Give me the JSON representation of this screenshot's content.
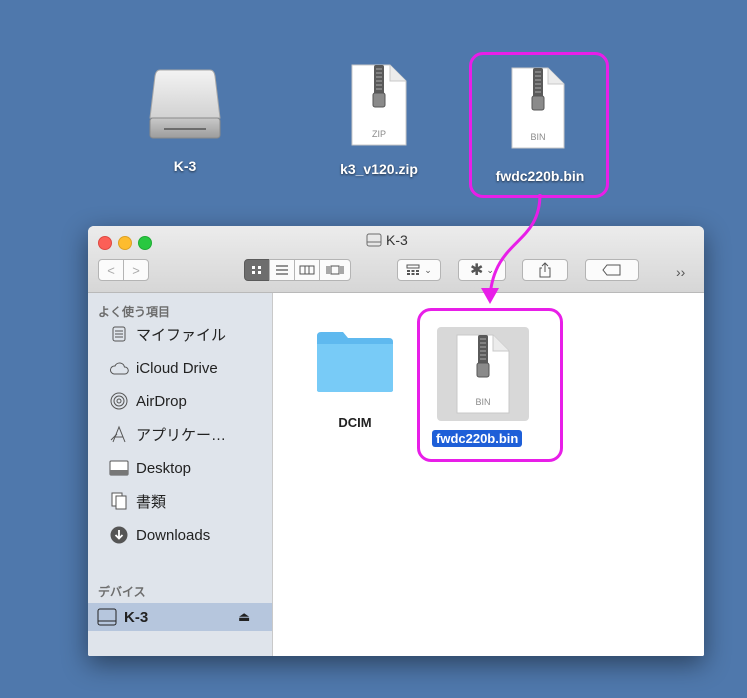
{
  "desktop": {
    "items": [
      {
        "label": "K-3"
      },
      {
        "label": "k3_v120.zip",
        "file_tag": "ZIP"
      },
      {
        "label": "fwdc220b.bin",
        "file_tag": "BIN"
      }
    ]
  },
  "window": {
    "title": "K-3",
    "toolbar": {
      "back": "<",
      "forward": ">",
      "more": "››"
    }
  },
  "sidebar": {
    "favorites_header": "よく使う項目",
    "favorites": [
      {
        "label": "マイファイル",
        "icon": "my-files-icon"
      },
      {
        "label": "iCloud Drive",
        "icon": "cloud-icon"
      },
      {
        "label": "AirDrop",
        "icon": "airdrop-icon"
      },
      {
        "label": "アプリケー…",
        "icon": "applications-icon"
      },
      {
        "label": "Desktop",
        "icon": "desktop-icon"
      },
      {
        "label": "書類",
        "icon": "documents-icon"
      },
      {
        "label": "Downloads",
        "icon": "downloads-icon"
      }
    ],
    "devices_header": "デバイス",
    "devices": [
      {
        "label": "K-3",
        "icon": "drive-icon"
      }
    ]
  },
  "content": {
    "items": [
      {
        "label": "DCIM"
      },
      {
        "label": "fwdc220b.bin",
        "file_tag": "BIN"
      }
    ]
  },
  "colors": {
    "desktop": "#4f78ac",
    "highlight": "#e81ee8",
    "selection": "#1e5fd8",
    "folder": "#6cc4f5"
  }
}
